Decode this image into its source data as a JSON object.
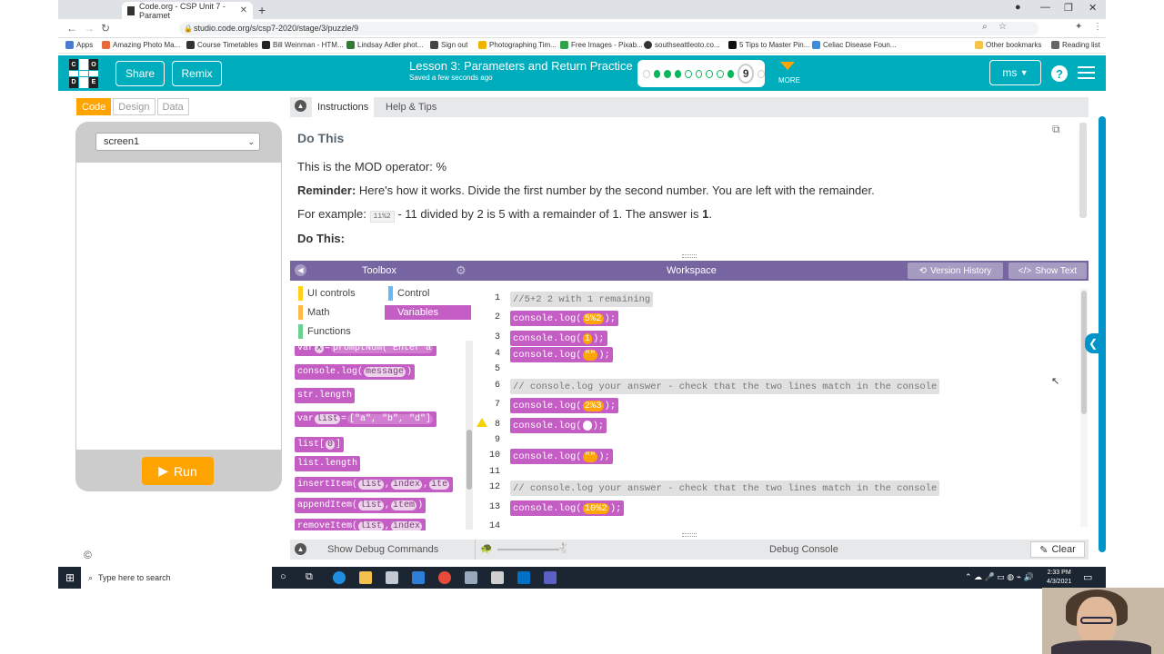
{
  "browser": {
    "tab_title": "Code.org - CSP Unit 7 - Paramet",
    "url": "studio.code.org/s/csp7-2020/stage/3/puzzle/9",
    "bookmarks": [
      "Apps",
      "Amazing Photo Ma...",
      "Course Timetables",
      "Bill Weinman - HTM...",
      "Lindsay Adler phot...",
      "Sign out",
      "Photographing Tim...",
      "Free Images - Pixab...",
      "southseattleoto.co...",
      "5 Tips to Master Pin...",
      "Celiac Disease Foun..."
    ],
    "other_bookmarks": "Other bookmarks",
    "reading_list": "Reading list"
  },
  "header": {
    "logo_letters": [
      "C",
      "O",
      "D",
      "E"
    ],
    "share_label": "Share",
    "remix_label": "Remix",
    "lesson_title": "Lesson 3: Parameters and Return Practice",
    "saved_text": "Saved a few seconds ago",
    "puzzle_number": "9",
    "more_label": "MORE",
    "user_label": "ms"
  },
  "left_panel": {
    "tabs": [
      "Code",
      "Design",
      "Data"
    ],
    "active_tab": "Code",
    "screen_select": "screen1",
    "run_label": "Run",
    "copyright": "©"
  },
  "instructions": {
    "tab_instructions": "Instructions",
    "tab_help": "Help & Tips",
    "heading": "Do This",
    "line1": "This is the MOD operator: %",
    "reminder_label": "Reminder:",
    "reminder_text": "Here's how it works. Divide the first number by the second number. You are left with the remainder.",
    "example_pre": "For example:",
    "example_code": "11%2",
    "example_text": "- 11 divided by 2 is 5 with a remainder of 1. The answer is",
    "example_answer": "1",
    "example_end": ".",
    "do_this": "Do This:"
  },
  "toolbox": {
    "title": "Toolbox",
    "categories": [
      {
        "label": "UI controls",
        "color": "#ffd11a"
      },
      {
        "label": "Control",
        "color": "#68b8f5"
      },
      {
        "label": "Math",
        "color": "#ffb74a"
      },
      {
        "label": "Variables",
        "color": "#c55ec4"
      },
      {
        "label": "Functions",
        "color": "#69d290"
      }
    ],
    "blocks": [
      {
        "pre": "var ",
        "args": [
          "x"
        ],
        "mid": " = ",
        "tail": "promptNum(\"Enter a"
      },
      {
        "pre": "console.log(",
        "args": [
          "message"
        ],
        "mid": ")",
        "tail": ""
      },
      {
        "pre": "str.length",
        "args": [],
        "mid": "",
        "tail": ""
      },
      {
        "pre": "var ",
        "args": [
          "list"
        ],
        "mid": " = ",
        "tail": "[\"a\", \"b\", \"d\"]"
      },
      {
        "pre": "list[",
        "args": [
          "0"
        ],
        "mid": "]",
        "tail": ""
      },
      {
        "pre": "list.length",
        "args": [],
        "mid": "",
        "tail": ""
      },
      {
        "pre": "insertItem(",
        "args": [
          "list",
          "index",
          "ite"
        ],
        "mid": "",
        "tail": ""
      },
      {
        "pre": "appendItem(",
        "args": [
          "list",
          "item"
        ],
        "mid": ")",
        "tail": ""
      },
      {
        "pre": "removeItem(",
        "args": [
          "list",
          "index"
        ],
        "mid": "",
        "tail": ""
      }
    ]
  },
  "workspace": {
    "title": "Workspace",
    "version_history": "Version History",
    "show_text": "Show Text",
    "lines": [
      {
        "n": "1",
        "kind": "comment",
        "text": "//5+2 2 with 1 remaining",
        "hl": false
      },
      {
        "n": "2",
        "kind": "call",
        "pre": "console.log(",
        "arg": "5%2",
        "post": ");"
      },
      {
        "n": "3",
        "kind": "call",
        "pre": "console.log(",
        "arg": "1",
        "post": ");"
      },
      {
        "n": "4",
        "kind": "call",
        "pre": "console.log(",
        "arg": "\"\"",
        "post": ");"
      },
      {
        "n": "5",
        "kind": "empty"
      },
      {
        "n": "6",
        "kind": "comment",
        "text": "// console.log your answer - check that the two lines match in the console",
        "hl": true
      },
      {
        "n": "7",
        "kind": "call",
        "pre": "console.log(",
        "arg": "2%3",
        "post": ");"
      },
      {
        "n": "8",
        "kind": "call",
        "pre": "console.log(",
        "arg": "",
        "post": ");",
        "warn": true
      },
      {
        "n": "9",
        "kind": "empty"
      },
      {
        "n": "10",
        "kind": "call",
        "pre": "console.log(",
        "arg": "\"\"",
        "post": ");"
      },
      {
        "n": "11",
        "kind": "empty"
      },
      {
        "n": "12",
        "kind": "comment",
        "text": "// console.log your answer - check that the two lines match in the console",
        "hl": false
      },
      {
        "n": "13",
        "kind": "call",
        "pre": "console.log(",
        "arg": "10%2",
        "post": ");"
      },
      {
        "n": "14",
        "kind": "empty"
      }
    ]
  },
  "debug": {
    "show_debug": "Show Debug Commands",
    "console_label": "Debug Console",
    "clear_label": "Clear"
  },
  "taskbar": {
    "search_placeholder": "Type here to search",
    "time": "2:33 PM",
    "date": "4/3/2021"
  }
}
